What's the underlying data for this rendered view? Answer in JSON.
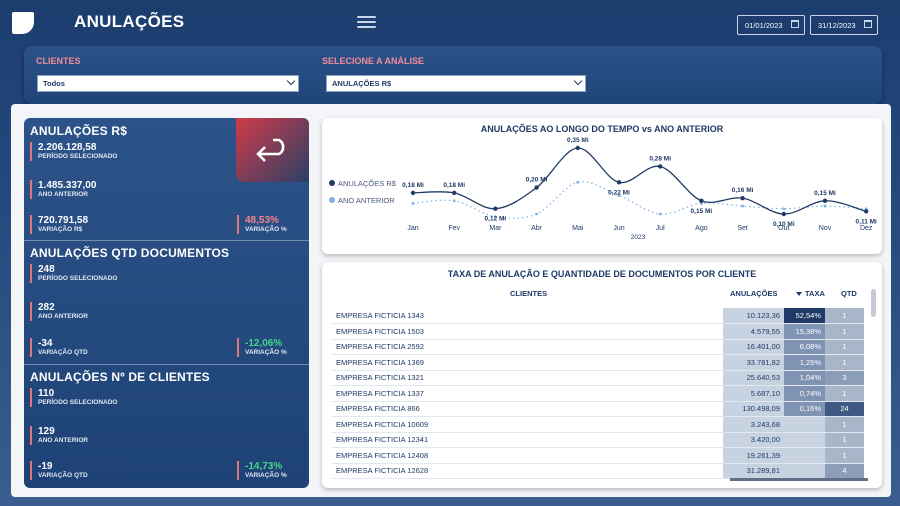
{
  "app": {
    "title": "ANULAÇÕES"
  },
  "header": {
    "date_from": "01/01/2023",
    "date_to": "31/12/2023"
  },
  "filters": {
    "clients_label": "CLIENTES",
    "clients_value": "Todos",
    "analysis_label": "SELECIONE A ANÁLISE",
    "analysis_value": "ANULAÇÕES R$"
  },
  "kpis": {
    "valor": {
      "title": "ANULAÇÕES R$",
      "current": "2.206.128,58",
      "current_label": "PERÍODO SELECIONADO",
      "previous": "1.485.337,00",
      "previous_label": "ANO ANTERIOR",
      "variation": "720.791,58",
      "variation_label": "VARIAÇÃO R$",
      "variation_pct": "48,53%",
      "variation_pct_label": "VARIAÇÃO %"
    },
    "qtd": {
      "title": "ANULAÇÕES QTD DOCUMENTOS",
      "current": "248",
      "current_label": "PERÍODO SELECIONADO",
      "previous": "282",
      "previous_label": "ANO ANTERIOR",
      "variation": "-34",
      "variation_label": "VARIAÇÃO QTD",
      "variation_pct": "-12,06%",
      "variation_pct_label": "VARIAÇÃO %"
    },
    "clientes": {
      "title": "ANULAÇÕES Nº DE CLIENTES",
      "current": "110",
      "current_label": "PERÍODO SELECIONADO",
      "previous": "129",
      "previous_label": "ANO ANTERIOR",
      "variation": "-19",
      "variation_label": "VARIAÇÃO QTD",
      "variation_pct": "-14,73%",
      "variation_pct_label": "VARIAÇÃO %"
    }
  },
  "colors": {
    "accent": "#e0747f",
    "line_current": "#1f3a66",
    "line_previous": "#7fb3e6",
    "positive": "#45d48b",
    "negative": "#f5828f"
  },
  "chart_data": {
    "type": "line",
    "title": "ANULAÇÕES AO LONGO DO TEMPO vs ANO ANTERIOR",
    "xlabel": "2023",
    "ylabel": "",
    "categories": [
      "Jan",
      "Fev",
      "Mar",
      "Abr",
      "Mai",
      "Jun",
      "Jul",
      "Ago",
      "Set",
      "Out",
      "Nov",
      "Dez"
    ],
    "series": [
      {
        "name": "ANULAÇÕES R$",
        "values": [
          0.18,
          0.18,
          0.12,
          0.2,
          0.35,
          0.22,
          0.28,
          0.15,
          0.16,
          0.1,
          0.15,
          0.11
        ],
        "labels": [
          "0,18 Mi",
          "0,18 Mi",
          "0,12 Mi",
          "0,20 Mi",
          "0,35 Mi",
          "0,22 Mi",
          "0,28 Mi",
          "0,15 Mi",
          "0,16 Mi",
          "0,10 Mi",
          "0,15 Mi",
          "0,11 Mi"
        ]
      },
      {
        "name": "ANO ANTERIOR",
        "values": [
          0.14,
          0.15,
          0.09,
          0.1,
          0.22,
          0.17,
          0.1,
          0.14,
          0.13,
          0.12,
          0.13,
          0.12
        ]
      }
    ],
    "legend": "left",
    "grid": false
  },
  "table": {
    "title": "TAXA DE ANULAÇÃO E QUANTIDADE DE DOCUMENTOS POR CLIENTE",
    "columns": [
      "CLIENTES",
      "ANULAÇÕES",
      "TAXA",
      "QTD"
    ],
    "rows": [
      {
        "cliente": "EMPRESA FICTICIA 1343",
        "anulacoes": "10.123,36",
        "taxa": "52,54%",
        "qtd": "1"
      },
      {
        "cliente": "EMPRESA FICTICIA 1503",
        "anulacoes": "4.579,55",
        "taxa": "15,38%",
        "qtd": "1"
      },
      {
        "cliente": "EMPRESA FICTICIA 2592",
        "anulacoes": "16.401,00",
        "taxa": "6,08%",
        "qtd": "1"
      },
      {
        "cliente": "EMPRESA FICTICIA 1369",
        "anulacoes": "33.781,82",
        "taxa": "1,25%",
        "qtd": "1"
      },
      {
        "cliente": "EMPRESA FICTICIA 1321",
        "anulacoes": "25.640,53",
        "taxa": "1,04%",
        "qtd": "3"
      },
      {
        "cliente": "EMPRESA FICTICIA 1337",
        "anulacoes": "5.687,10",
        "taxa": "0,74%",
        "qtd": "1"
      },
      {
        "cliente": "EMPRESA FICTICIA 866",
        "anulacoes": "130.498,09",
        "taxa": "0,16%",
        "qtd": "24"
      },
      {
        "cliente": "EMPRESA FICTICIA 10609",
        "anulacoes": "3.243,68",
        "taxa": "",
        "qtd": "1"
      },
      {
        "cliente": "EMPRESA FICTICIA 12341",
        "anulacoes": "3.420,00",
        "taxa": "",
        "qtd": "1"
      },
      {
        "cliente": "EMPRESA FICTICIA 12408",
        "anulacoes": "19.261,39",
        "taxa": "",
        "qtd": "1"
      },
      {
        "cliente": "EMPRESA FICTICIA 12628",
        "anulacoes": "31.289,81",
        "taxa": "",
        "qtd": "4"
      }
    ]
  }
}
